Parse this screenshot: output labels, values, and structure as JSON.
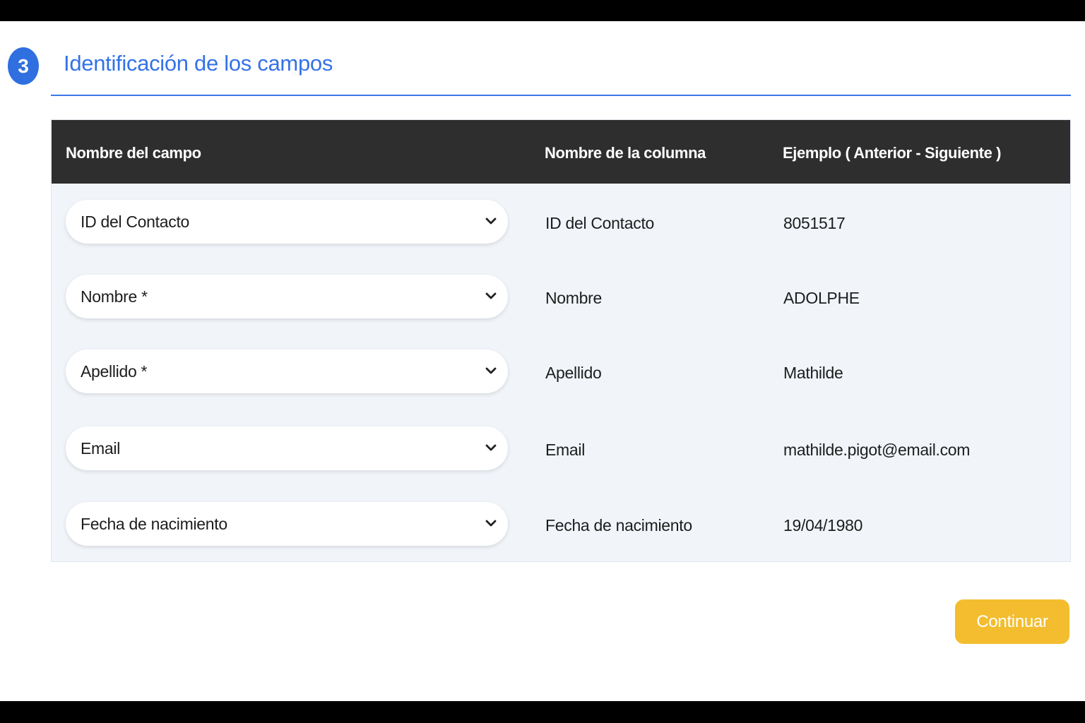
{
  "step": {
    "number": "3",
    "title": "Identificación de los campos"
  },
  "table": {
    "headers": {
      "field_name": "Nombre del campo",
      "column_name": "Nombre de la columna",
      "example": "Ejemplo ( Anterior - Siguiente )"
    },
    "rows": [
      {
        "field": "ID del Contacto",
        "column": "ID del Contacto",
        "example": "8051517"
      },
      {
        "field": "Nombre *",
        "column": "Nombre",
        "example": "ADOLPHE"
      },
      {
        "field": "Apellido *",
        "column": "Apellido",
        "example": "Mathilde"
      },
      {
        "field": "Email",
        "column": "Email",
        "example": "mathilde.pigot@email.com"
      },
      {
        "field": "Fecha de nacimiento",
        "column": "Fecha de nacimiento",
        "example": "19/04/1980"
      }
    ]
  },
  "actions": {
    "continue_label": "Continuar"
  },
  "icons": {
    "dropdown": "chevron-down-icon"
  },
  "colors": {
    "accent_blue": "#3472e6",
    "header_dark": "#2e2e2e",
    "button_yellow": "#f3bd2f",
    "table_bg": "#f1f5fa"
  }
}
